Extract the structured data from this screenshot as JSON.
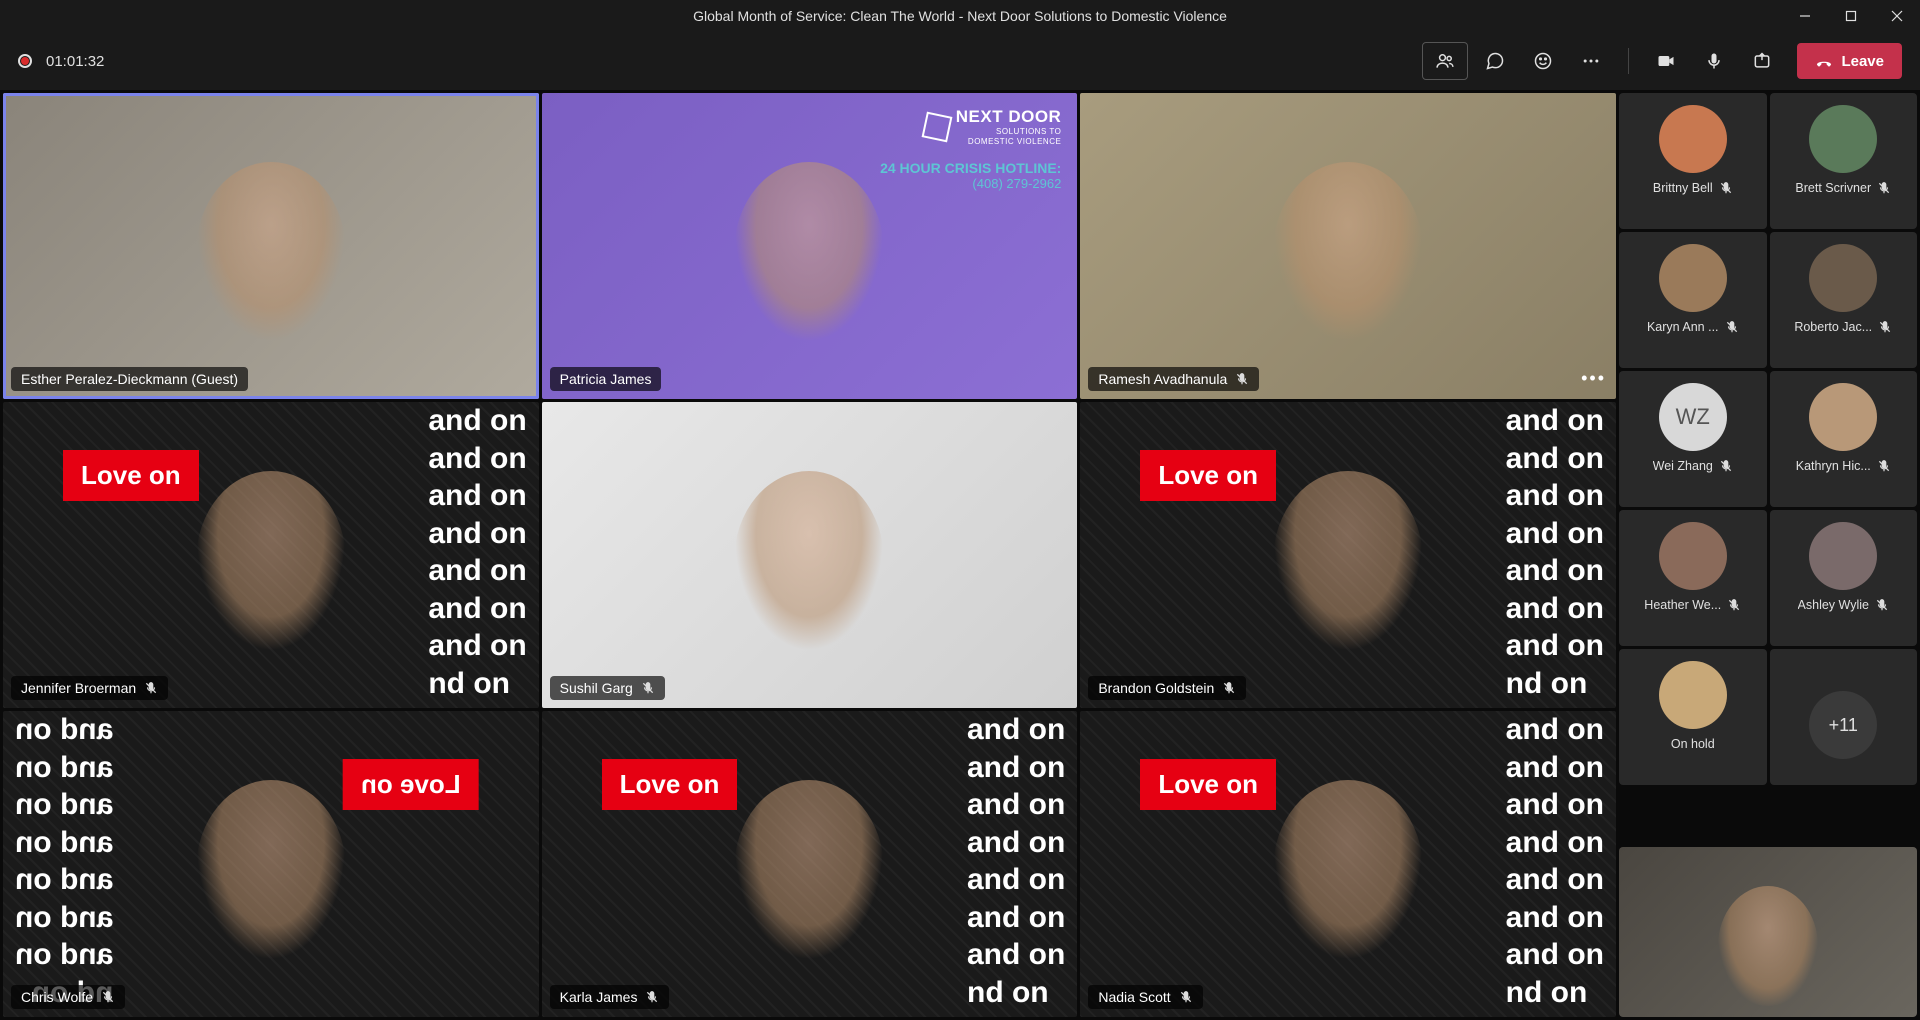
{
  "titlebar": {
    "title": "Global Month of Service: Clean The World - Next Door Solutions to Domestic Violence"
  },
  "toolbar": {
    "timer": "01:01:32",
    "leave_label": "Leave"
  },
  "nextdoor": {
    "brand": "NEXT DOOR",
    "tagline1": "SOLUTIONS TO",
    "tagline2": "DOMESTIC VIOLENCE",
    "hotline_label": "24 HOUR CRISIS HOTLINE:",
    "hotline_number": "(408) 279-2962"
  },
  "loveon": "Love on",
  "andon": "and on\nand on\nand on\nand on\nand on\nand on\nand on\nnd on",
  "tiles": [
    {
      "name": "Esther Peralez-Dieckmann (Guest)",
      "muted": false,
      "speaking": true,
      "bg": "office"
    },
    {
      "name": "Patricia James",
      "muted": false,
      "speaking": false,
      "bg": "purple",
      "nextdoor": true
    },
    {
      "name": "Ramesh Avadhanula",
      "muted": true,
      "speaking": false,
      "bg": "basement",
      "more": true
    },
    {
      "name": "Jennifer Broerman",
      "muted": true,
      "speaking": false,
      "bg": "pattern",
      "loveon": true
    },
    {
      "name": "Sushil Garg",
      "muted": true,
      "speaking": false,
      "bg": "white"
    },
    {
      "name": "Brandon Goldstein",
      "muted": true,
      "speaking": false,
      "bg": "pattern",
      "loveon": true
    },
    {
      "name": "Chris Wolfe",
      "muted": true,
      "speaking": false,
      "bg": "pattern",
      "loveon": true,
      "flipped": true
    },
    {
      "name": "Karla James",
      "muted": true,
      "speaking": false,
      "bg": "pattern",
      "loveon": true
    },
    {
      "name": "Nadia Scott",
      "muted": true,
      "speaking": false,
      "bg": "pattern",
      "loveon": true
    }
  ],
  "participants": [
    {
      "name": "Brittny Bell",
      "muted": true,
      "color": "#c87850"
    },
    {
      "name": "Brett Scrivner",
      "muted": true,
      "color": "#5a7a5a"
    },
    {
      "name": "Karyn Ann ...",
      "muted": true,
      "color": "#9a7a5a"
    },
    {
      "name": "Roberto Jac...",
      "muted": true,
      "color": "#6a5a4a"
    },
    {
      "name": "Wei Zhang",
      "muted": true,
      "initials": "WZ",
      "color": "#d8d8d8",
      "textcolor": "#555"
    },
    {
      "name": "Kathryn Hic...",
      "muted": true,
      "color": "#b89878"
    },
    {
      "name": "Heather We...",
      "muted": true,
      "color": "#8a6a5a"
    },
    {
      "name": "Ashley Wylie",
      "muted": true,
      "color": "#7a6a6a"
    },
    {
      "name": "On hold",
      "muted": false,
      "color": "#c8a878",
      "onhold": true
    }
  ],
  "overflow": "+11"
}
